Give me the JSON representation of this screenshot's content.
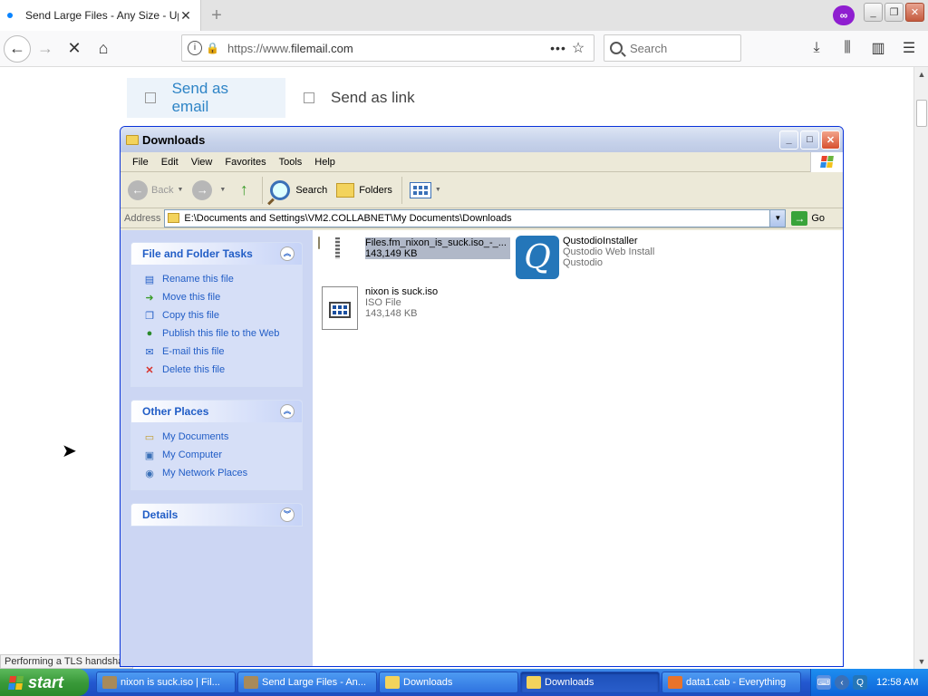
{
  "browser": {
    "tab_title": "Send Large Files - Any Size - Up To",
    "tab_close": "✕",
    "new_tab": "+",
    "url_host": "https://www.",
    "url_domain": "filemail.com",
    "url_more": "•••",
    "search_placeholder": "Search"
  },
  "page": {
    "tabs": [
      {
        "label": "Send as email"
      },
      {
        "label": "Send as link"
      }
    ],
    "status_text": "Performing a TLS handshak"
  },
  "explorer": {
    "title": "Downloads",
    "menu": [
      "File",
      "Edit",
      "View",
      "Favorites",
      "Tools",
      "Help"
    ],
    "toolbar": {
      "back": "Back",
      "search": "Search",
      "folders": "Folders"
    },
    "address_label": "Address",
    "address": "E:\\Documents and Settings\\VM2.COLLABNET\\My Documents\\Downloads",
    "go_label": "Go",
    "panels": {
      "file_tasks": {
        "title": "File and Folder Tasks",
        "items": [
          "Rename this file",
          "Move this file",
          "Copy this file",
          "Publish this file to the Web",
          "E-mail this file",
          "Delete this file"
        ]
      },
      "other_places": {
        "title": "Other Places",
        "items": [
          "My Documents",
          "My Computer",
          "My Network Places"
        ]
      },
      "details": {
        "title": "Details"
      }
    },
    "files": [
      {
        "name": "Files.fm_nixon_is_suck.iso_-_...",
        "sub1": "143,149 KB",
        "sub2": ""
      },
      {
        "name": "QustodioInstaller",
        "sub1": "Qustodio Web Install",
        "sub2": "Qustodio"
      },
      {
        "name": "nixon is suck.iso",
        "sub1": "ISO File",
        "sub2": "143,148 KB"
      }
    ]
  },
  "taskbar": {
    "start_label": "start",
    "tasks": [
      {
        "label": "nixon is suck.iso | Fil..."
      },
      {
        "label": "Send Large Files - An..."
      },
      {
        "label": "Downloads"
      },
      {
        "label": "Downloads"
      },
      {
        "label": "data1.cab - Everything"
      }
    ],
    "clock": "12:58 AM"
  },
  "colors": {
    "accent": "#2e84c6",
    "xp_blue": "#215dc6",
    "taskbar_blue": "#2358d0",
    "start_green": "#3a9a3a"
  }
}
